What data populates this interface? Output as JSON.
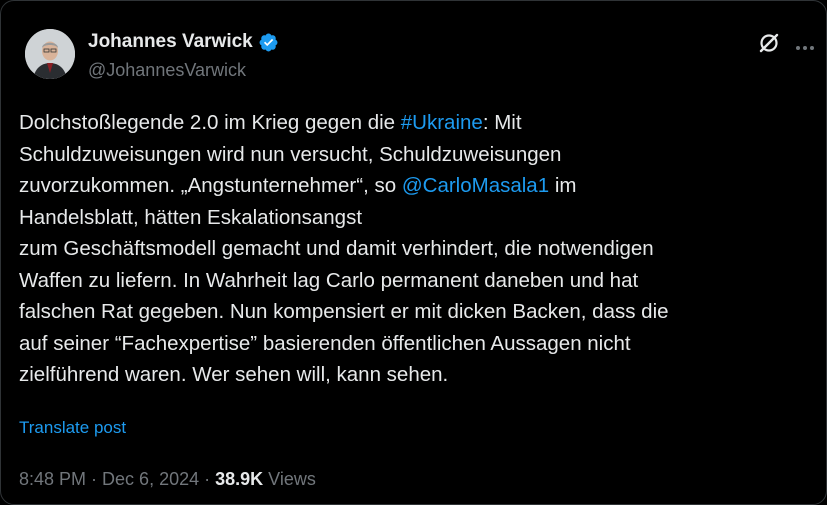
{
  "author": {
    "display_name": "Johannes Varwick",
    "handle": "@JohannesVarwick",
    "verified": true
  },
  "tweet": {
    "lines": [
      [
        {
          "text": "Dolchstoßlegende 2.0 im Krieg gegen die "
        },
        {
          "text": "#Ukraine",
          "link": true
        },
        {
          "text": ": Mit"
        }
      ],
      [
        {
          "text": "Schuldzuweisungen wird nun versucht, Schuldzuweisungen"
        }
      ],
      [
        {
          "text": "zuvorzukommen. „Angstunternehmer“, so "
        },
        {
          "text": "@CarloMasala1",
          "link": true
        },
        {
          "text": " im"
        }
      ],
      [
        {
          "text": "Handelsblatt, hätten Eskalationsangst"
        }
      ],
      [
        {
          "text": "zum Geschäftsmodell gemacht und damit verhindert, die notwendigen"
        }
      ],
      [
        {
          "text": "Waffen zu liefern. In Wahrheit lag Carlo permanent daneben und hat"
        }
      ],
      [
        {
          "text": "falschen Rat gegeben. Nun kompensiert er mit dicken Backen, dass die"
        }
      ],
      [
        {
          "text": "auf seiner “Fachexpertise” basierenden öffentlichen Aussagen nicht"
        }
      ],
      [
        {
          "text": "zielführend waren. Wer sehen will, kann sehen."
        }
      ]
    ]
  },
  "translate_label": "Translate post",
  "meta": {
    "time": "8:48 PM",
    "separator": " · ",
    "date": "Dec 6, 2024",
    "views_count": "38.9K",
    "views_label": " Views"
  },
  "icons": {
    "verified": "verified-badge-icon",
    "grok": "grok-icon",
    "more": "more-icon"
  },
  "colors": {
    "background": "#000000",
    "text": "#e7e9ea",
    "muted": "#71767b",
    "link": "#1d9bf0",
    "verified": "#1d9bf0"
  }
}
